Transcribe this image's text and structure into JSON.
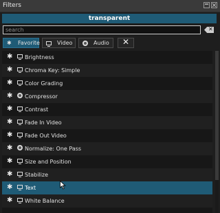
{
  "panel": {
    "title": "Filters"
  },
  "clip": {
    "name": "transparent"
  },
  "search": {
    "placeholder": "search",
    "clear_icon": "clear-icon"
  },
  "tabs": [
    {
      "label": "Favorite",
      "icon": "star-icon",
      "active": true
    },
    {
      "label": "Video",
      "icon": "monitor-icon",
      "active": false
    },
    {
      "label": "Audio",
      "icon": "speaker-icon",
      "active": false
    }
  ],
  "filters": [
    {
      "name": "Brightness",
      "type": "video"
    },
    {
      "name": "Chroma Key: Simple",
      "type": "video"
    },
    {
      "name": "Color Grading",
      "type": "video"
    },
    {
      "name": "Compressor",
      "type": "audio"
    },
    {
      "name": "Contrast",
      "type": "video"
    },
    {
      "name": "Fade In Video",
      "type": "video"
    },
    {
      "name": "Fade Out Video",
      "type": "video"
    },
    {
      "name": "Normalize: One Pass",
      "type": "audio"
    },
    {
      "name": "Size and Position",
      "type": "video"
    },
    {
      "name": "Stabilize",
      "type": "video"
    },
    {
      "name": "Text",
      "type": "video",
      "selected": true
    },
    {
      "name": "White Balance",
      "type": "video"
    }
  ],
  "colors": {
    "accent": "#1f5b76",
    "background": "#1e1e1e",
    "list_alt": "#202020"
  }
}
